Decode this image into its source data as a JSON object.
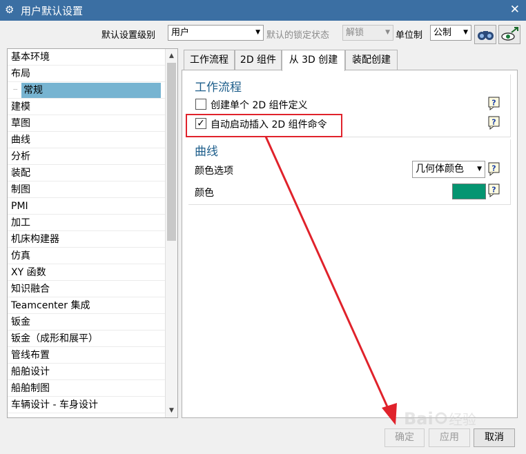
{
  "window": {
    "title": "用户默认设置",
    "close": "✕",
    "gear": "⚙"
  },
  "toolbar": {
    "level_label": "默认设置级别",
    "level_value": "用户",
    "lock_label": "默认的锁定状态",
    "lock_value": "解锁",
    "unit_label": "单位制",
    "unit_value": "公制",
    "icons": [
      "binoculars-icon",
      "eye-arrow-icon"
    ]
  },
  "tree": {
    "items": [
      {
        "label": "基本环境",
        "child": false
      },
      {
        "label": "布局",
        "child": false
      },
      {
        "label": "常规",
        "child": true,
        "selected": true
      },
      {
        "label": "建模",
        "child": false
      },
      {
        "label": "草图",
        "child": false
      },
      {
        "label": "曲线",
        "child": false
      },
      {
        "label": "分析",
        "child": false
      },
      {
        "label": "装配",
        "child": false
      },
      {
        "label": "制图",
        "child": false
      },
      {
        "label": "PMI",
        "child": false
      },
      {
        "label": "加工",
        "child": false
      },
      {
        "label": "机床构建器",
        "child": false
      },
      {
        "label": "仿真",
        "child": false
      },
      {
        "label": "XY 函数",
        "child": false
      },
      {
        "label": "知识融合",
        "child": false
      },
      {
        "label": "Teamcenter 集成",
        "child": false
      },
      {
        "label": "钣金",
        "child": false
      },
      {
        "label": "钣金（成形和展平）",
        "child": false
      },
      {
        "label": "管线布置",
        "child": false
      },
      {
        "label": "船舶设计",
        "child": false
      },
      {
        "label": "船舶制图",
        "child": false
      },
      {
        "label": "车辆设计 - 车身设计",
        "child": false
      }
    ]
  },
  "tabs": [
    {
      "label": "工作流程",
      "active": false
    },
    {
      "label": "2D 组件",
      "active": false
    },
    {
      "label": "从 3D 创建",
      "active": true
    },
    {
      "label": "装配创建",
      "active": false
    }
  ],
  "workflow": {
    "title": "工作流程",
    "options": [
      {
        "label": "创建单个 2D 组件定义",
        "checked": false
      },
      {
        "label": "自动启动插入 2D 组件命令",
        "checked": true
      }
    ]
  },
  "curve": {
    "title": "曲线",
    "color_option_label": "颜色选项",
    "color_option_value": "几何体颜色",
    "color_label": "颜色",
    "color_value": "#059571"
  },
  "help_glyph": "?",
  "check_glyph": "✓",
  "buttons": {
    "ok": "确定",
    "apply": "应用",
    "cancel": "取消"
  },
  "watermark": {
    "text": "Bai",
    "suffix": "经验"
  },
  "colors": {
    "titlebar": "#3b6fa3",
    "selection": "#77b4d1",
    "annotation": "#e0222b",
    "group_title": "#1c5d8a"
  }
}
